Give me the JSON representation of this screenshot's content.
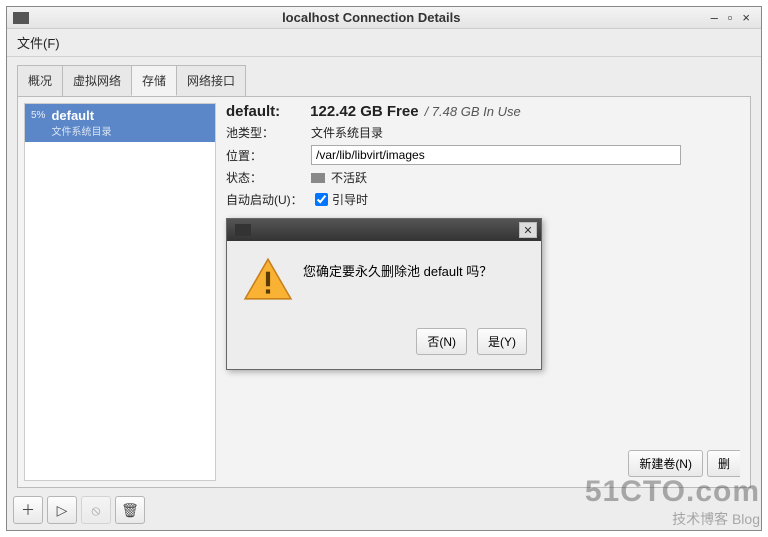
{
  "window": {
    "title": "localhost Connection Details",
    "menu_file": "文件(F)"
  },
  "tabs": [
    "概况",
    "虚拟网络",
    "存储",
    "网络接口"
  ],
  "active_tab": 2,
  "pool": {
    "percent": "5%",
    "name": "default",
    "subtitle": "文件系统目录"
  },
  "details": {
    "name_label": "default:",
    "free": "122.42 GB Free",
    "used": "/ 7.48 GB In Use",
    "pool_type_label": "池类型：",
    "pool_type_value": "文件系统目录",
    "location_label": "位置：",
    "location_value": "/var/lib/libvirt/images",
    "state_label": "状态：",
    "state_value": "不活跃",
    "autostart_label": "自动启动(U)：",
    "autostart_value": "引导时",
    "autostart_checked": true
  },
  "dialog": {
    "message": "您确定要永久删除池 default 吗？",
    "no": "否(N)",
    "yes": "是(Y)"
  },
  "buttons": {
    "new_volume": "新建卷(N)",
    "delete_volume": "删"
  },
  "icons": {
    "add": "＋",
    "play": "▷",
    "stop": "⦸",
    "trash": "🗑",
    "close": "✕"
  },
  "watermark": {
    "line1": "51CTO.com",
    "line2": "技术博客   Blog"
  }
}
